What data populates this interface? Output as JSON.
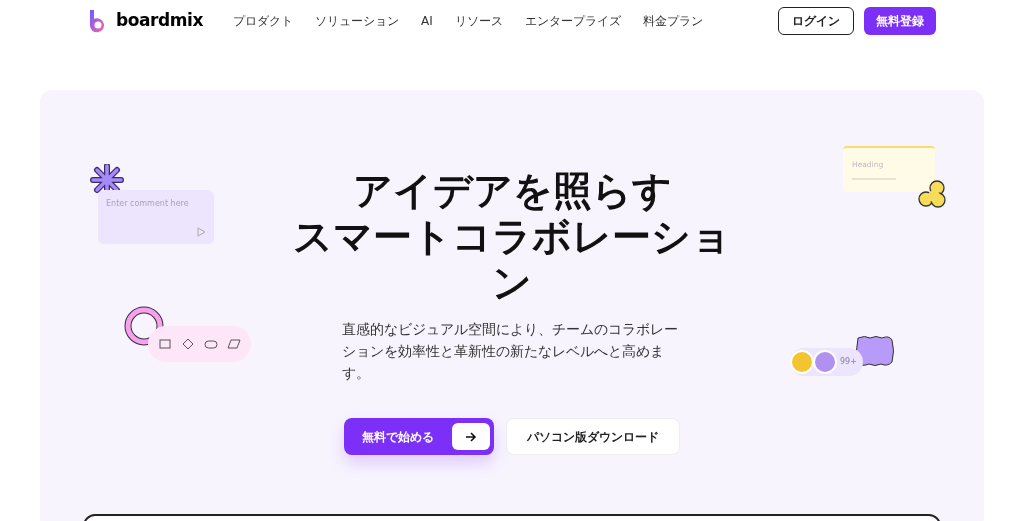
{
  "header": {
    "logo": "boardmix",
    "nav": [
      "プロダクト",
      "ソリューション",
      "AI",
      "リソース",
      "エンタープライズ",
      "料金プラン"
    ],
    "login": "ログイン",
    "signup": "無料登録"
  },
  "hero": {
    "title_lines": [
      "アイデアを照らす",
      "スマートコラボレーション"
    ],
    "subtitle": "直感的なビジュアル空間により、チームのコラボレーションを効率性と革新性の新たなレベルへと高めます。",
    "primary_button": "無料で始める",
    "secondary_button": "パソコン版ダウンロード"
  },
  "decor": {
    "comment_placeholder": "Enter comment here",
    "note_heading": "Heading",
    "avatar_count": "99+"
  }
}
